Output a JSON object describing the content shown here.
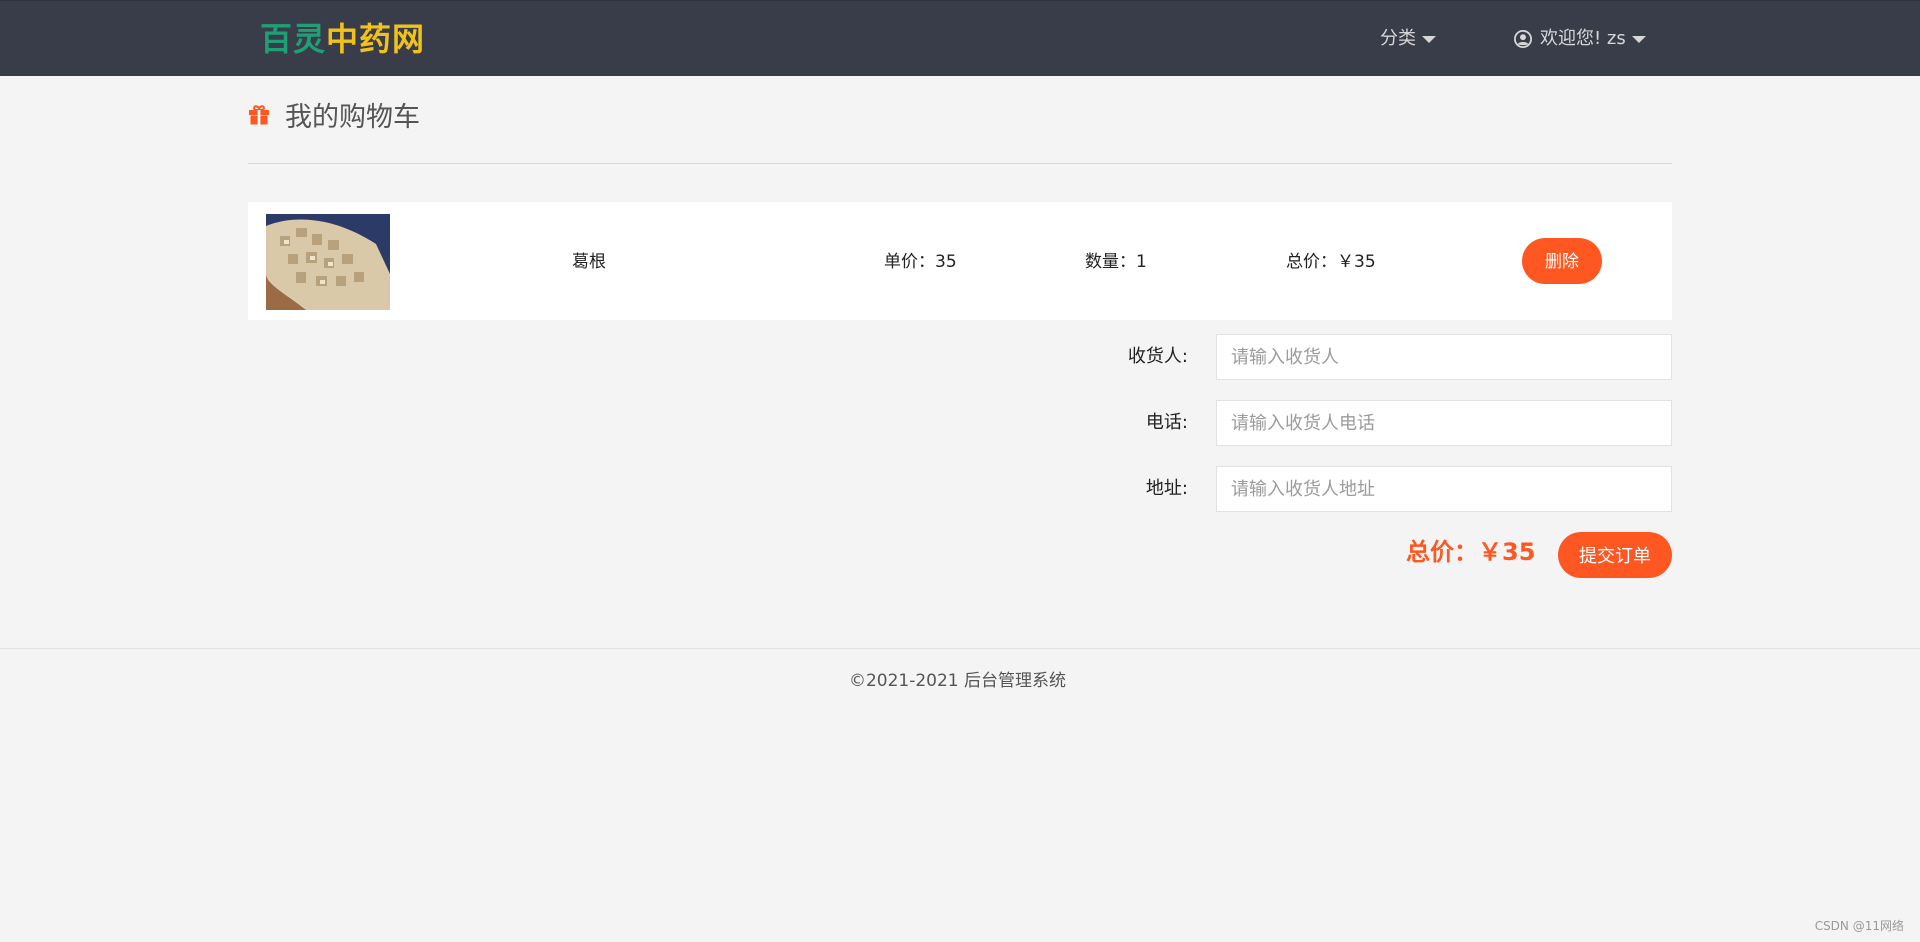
{
  "header": {
    "logo_part1": "百灵",
    "logo_part2": "中药网",
    "category_label": "分类",
    "welcome_label": "欢迎您! zs"
  },
  "page": {
    "title": "我的购物车"
  },
  "cart": {
    "items": [
      {
        "name": "葛根",
        "unit_price": "单价：35",
        "quantity": "数量：1",
        "subtotal": "总价：￥35",
        "delete_label": "删除"
      }
    ]
  },
  "form": {
    "receiver_label": "收货人:",
    "receiver_placeholder": "请输入收货人",
    "phone_label": "电话:",
    "phone_placeholder": "请输入收货人电话",
    "address_label": "地址:",
    "address_placeholder": "请输入收货人地址"
  },
  "order": {
    "total": "总价：￥35",
    "submit_label": "提交订单"
  },
  "footer": {
    "copyright": "©2021-2021   后台管理系统"
  },
  "watermark": "CSDN @11网络",
  "colors": {
    "header_bg": "#393d49",
    "accent": "#ff5722",
    "logo_green": "#1e9f76",
    "logo_yellow": "#f2c21b"
  }
}
